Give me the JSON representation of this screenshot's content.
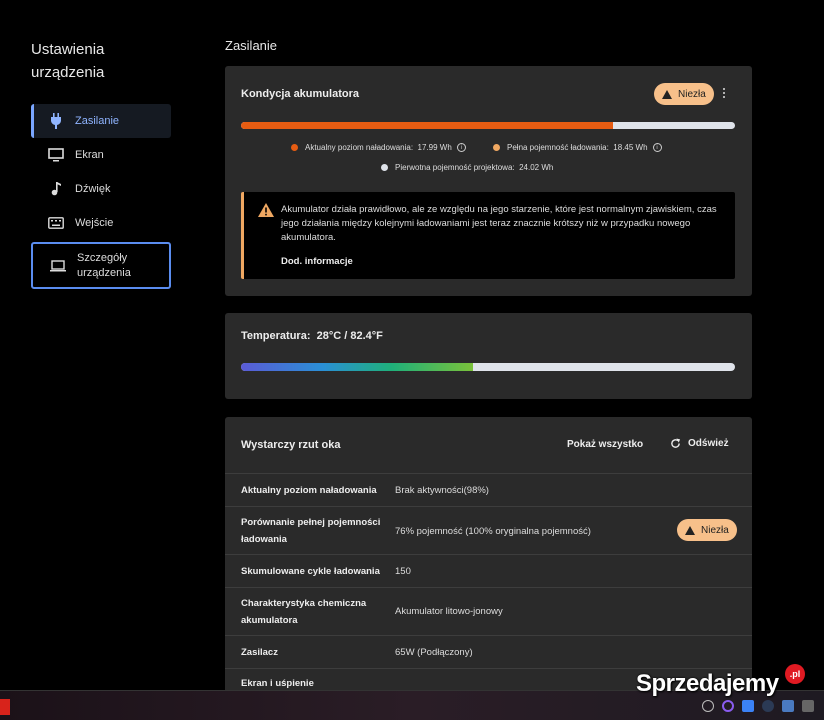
{
  "sidebar": {
    "title": "Ustawienia urządzenia",
    "items": [
      {
        "label": "Zasilanie",
        "icon": "plug-icon"
      },
      {
        "label": "Ekran",
        "icon": "monitor-icon"
      },
      {
        "label": "Dźwięk",
        "icon": "music-note-icon"
      },
      {
        "label": "Wejście",
        "icon": "keyboard-icon"
      },
      {
        "label": "Szczegóły urządzenia",
        "icon": "laptop-icon"
      }
    ]
  },
  "main": {
    "title": "Zasilanie",
    "battery": {
      "heading": "Kondycja akumulatora",
      "badge": "Niezła",
      "current_charge_fraction": 0.7529,
      "legend": {
        "current": "Aktualny poziom naładowania:",
        "current_value": "17.99 Wh",
        "full": "Pełna pojemność ładowania:",
        "full_value": "18.45 Wh",
        "design": "Pierwotna pojemność projektowa:",
        "design_value": "24.02 Wh"
      },
      "alert_text": "Akumulator działa prawidłowo, ale ze względu na jego starzenie, które jest normalnym zjawiskiem, czas jego działania między kolejnymi ładowaniami jest teraz znacznie krótszy niż w przypadku nowego akumulatora.",
      "alert_link": "Dod. informacje"
    },
    "temperature": {
      "heading": "Temperatura:",
      "value": "28°C / 82.4°F",
      "level_fraction": 0.47
    },
    "overview": {
      "heading": "Wystarczy rzut oka",
      "show_all": "Pokaż wszystko",
      "refresh": "Odśwież",
      "rows": [
        {
          "key": "Aktualny poziom naładowania",
          "value": "Brak aktywności(98%)"
        },
        {
          "key": "Porównanie pełnej pojemności ładowania",
          "value": "76% pojemność (100% oryginalna pojemność)",
          "badge": "Niezła"
        },
        {
          "key": "Skumulowane cykle ładowania",
          "value": "150"
        },
        {
          "key": "Charakterystyka chemiczna akumulatora",
          "value": "Akumulator litowo-jonowy"
        },
        {
          "key": "Zasilacz",
          "value": "65W (Podłączony)"
        },
        {
          "key": "Ekran i uśpienie",
          "value": ""
        }
      ]
    }
  },
  "watermark": {
    "text": "Sprzedajemy",
    "suffix": ".pl"
  },
  "colors": {
    "accent": "#7aa6ff",
    "warning": "#f7c08a",
    "battery_fill": "#e65c12"
  }
}
